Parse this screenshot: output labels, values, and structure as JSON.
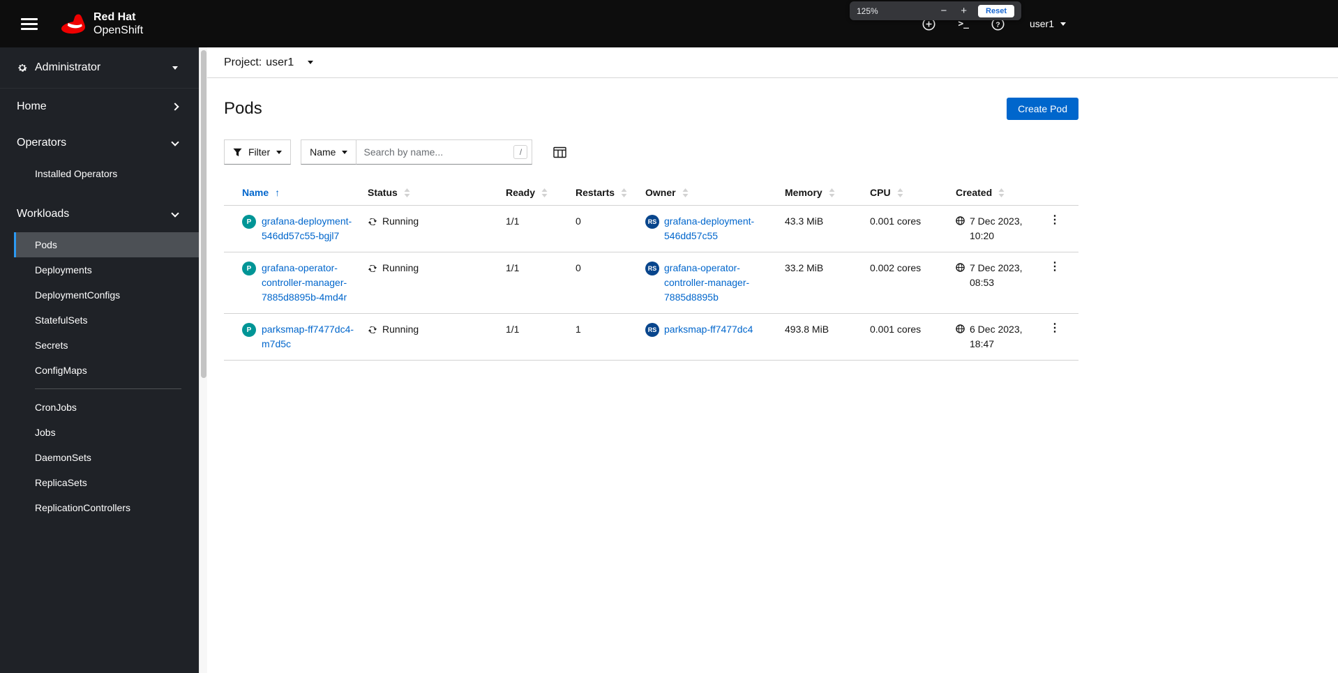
{
  "masthead": {
    "brand_line1": "Red Hat",
    "brand_line2": "OpenShift",
    "username": "user1",
    "zoom": {
      "level": "125%",
      "minus": "−",
      "plus": "+",
      "reset": "Reset"
    }
  },
  "sidebar": {
    "perspective": "Administrator",
    "home": "Home",
    "operators": "Operators",
    "operators_items": [
      "Installed Operators"
    ],
    "workloads": "Workloads",
    "workloads_items": [
      "Pods",
      "Deployments",
      "DeploymentConfigs",
      "StatefulSets",
      "Secrets",
      "ConfigMaps",
      "CronJobs",
      "Jobs",
      "DaemonSets",
      "ReplicaSets",
      "ReplicationControllers"
    ],
    "selected_item": "Pods"
  },
  "project_bar": {
    "label": "Project:",
    "value": "user1"
  },
  "page": {
    "title": "Pods",
    "create_button_label": "Create Pod"
  },
  "toolbar": {
    "filter_label": "Filter",
    "attribute_label": "Name",
    "search_placeholder": "Search by name...",
    "search_shortcut": "/"
  },
  "table": {
    "columns": [
      "Name",
      "Status",
      "Ready",
      "Restarts",
      "Owner",
      "Memory",
      "CPU",
      "Created"
    ],
    "sort": {
      "column": "Name",
      "direction": "ascending"
    },
    "rows": [
      {
        "badge": "P",
        "name": "grafana-deployment-546dd57c55-bgjl7",
        "status": "Running",
        "ready": "1/1",
        "restarts": "0",
        "owner_badge": "RS",
        "owner": "grafana-deployment-546dd57c55",
        "memory": "43.3 MiB",
        "cpu": "0.001 cores",
        "created": "7 Dec 2023, 10:20"
      },
      {
        "badge": "P",
        "name": "grafana-operator-controller-manager-7885d8895b-4md4r",
        "status": "Running",
        "ready": "1/1",
        "restarts": "0",
        "owner_badge": "RS",
        "owner": "grafana-operator-controller-manager-7885d8895b",
        "memory": "33.2 MiB",
        "cpu": "0.002 cores",
        "created": "7 Dec 2023, 08:53"
      },
      {
        "badge": "P",
        "name": "parksmap-ff7477dc4-m7d5c",
        "status": "Running",
        "ready": "1/1",
        "restarts": "1",
        "owner_badge": "RS",
        "owner": "parksmap-ff7477dc4",
        "memory": "493.8 MiB",
        "cpu": "0.001 cores",
        "created": "6 Dec 2023, 18:47"
      }
    ]
  },
  "icons": {
    "kebab": "⋮",
    "sort_ascending": "↑"
  },
  "colors": {
    "primary_blue": "#0066cc",
    "link_blue": "#0066cc",
    "pod_badge_teal": "#009596",
    "replicaset_badge_blue": "#08458c",
    "brand_red": "#ee0000",
    "masthead_black": "#0d0d0d",
    "sidebar_gray": "#1f2227",
    "selected_nav_gray": "#4c5055",
    "selected_indicator_blue": "#2b9af3"
  }
}
